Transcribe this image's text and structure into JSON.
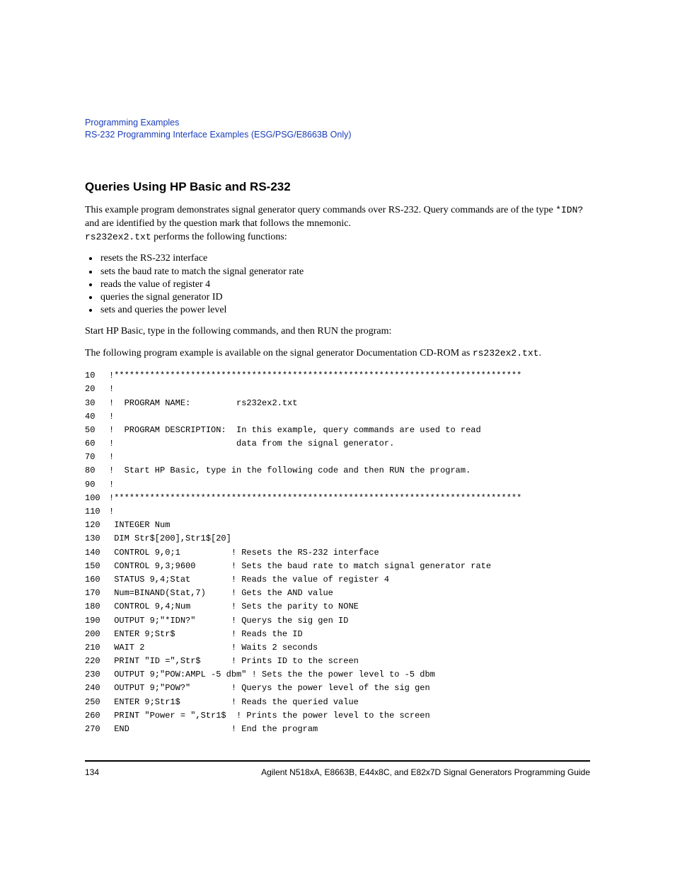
{
  "header": {
    "line1": "Programming Examples",
    "line2": "RS-232 Programming Interface Examples (ESG/PSG/E8663B Only)"
  },
  "section_title": "Queries Using HP Basic and RS-232",
  "para1_a": "This example program demonstrates signal generator query commands over RS-232. Query commands are of the type ",
  "para1_code": "*IDN?",
  "para1_b": " and are identified by the question mark that follows the mnemonic.",
  "para1_file": "rs232ex2.txt",
  "para1_c": " performs the following functions:",
  "bullets": [
    "resets the RS-232 interface",
    "sets the baud rate to match the signal generator rate",
    "reads the value of register 4",
    "queries the signal generator ID",
    "sets and queries the power level"
  ],
  "para2": "Start HP Basic, type in the following commands, and then RUN the program:",
  "para3_a": "The following program example is available on the signal generator Documentation CD-ROM as ",
  "para3_file": "rs232ex2.txt",
  "para3_b": ".",
  "code": [
    {
      "n": "10",
      "t": "!********************************************************************************"
    },
    {
      "n": "20",
      "t": "!"
    },
    {
      "n": "30",
      "t": "!  PROGRAM NAME:         rs232ex2.txt"
    },
    {
      "n": "40",
      "t": "!"
    },
    {
      "n": "50",
      "t": "!  PROGRAM DESCRIPTION:  In this example, query commands are used to read"
    },
    {
      "n": "60",
      "t": "!                        data from the signal generator."
    },
    {
      "n": "70",
      "t": "!"
    },
    {
      "n": "80",
      "t": "!  Start HP Basic, type in the following code and then RUN the program."
    },
    {
      "n": "90",
      "t": "!"
    },
    {
      "n": "100",
      "t": "!********************************************************************************"
    },
    {
      "n": "110",
      "t": "!"
    },
    {
      "n": "120",
      "t": " INTEGER Num"
    },
    {
      "n": "130",
      "t": " DIM Str$[200],Str1$[20]"
    },
    {
      "n": "140",
      "t": " CONTROL 9,0;1          ! Resets the RS-232 interface"
    },
    {
      "n": "150",
      "t": " CONTROL 9,3;9600       ! Sets the baud rate to match signal generator rate"
    },
    {
      "n": "160",
      "t": " STATUS 9,4;Stat        ! Reads the value of register 4"
    },
    {
      "n": "170",
      "t": " Num=BINAND(Stat,7)     ! Gets the AND value"
    },
    {
      "n": "180",
      "t": " CONTROL 9,4;Num        ! Sets the parity to NONE"
    },
    {
      "n": "190",
      "t": " OUTPUT 9;\"*IDN?\"       ! Querys the sig gen ID"
    },
    {
      "n": "200",
      "t": " ENTER 9;Str$           ! Reads the ID"
    },
    {
      "n": "210",
      "t": " WAIT 2                 ! Waits 2 seconds"
    },
    {
      "n": "220",
      "t": " PRINT \"ID =\",Str$      ! Prints ID to the screen"
    },
    {
      "n": "230",
      "t": " OUTPUT 9;\"POW:AMPL -5 dbm\" ! Sets the the power level to -5 dbm"
    },
    {
      "n": "240",
      "t": " OUTPUT 9;\"POW?\"        ! Querys the power level of the sig gen"
    },
    {
      "n": "250",
      "t": " ENTER 9;Str1$          ! Reads the queried value"
    },
    {
      "n": "260",
      "t": " PRINT \"Power = \",Str1$  ! Prints the power level to the screen"
    },
    {
      "n": "270",
      "t": " END                    ! End the program"
    }
  ],
  "footer": {
    "page_number": "134",
    "right": "Agilent N518xA, E8663B, E44x8C, and E82x7D Signal Generators Programming Guide"
  }
}
